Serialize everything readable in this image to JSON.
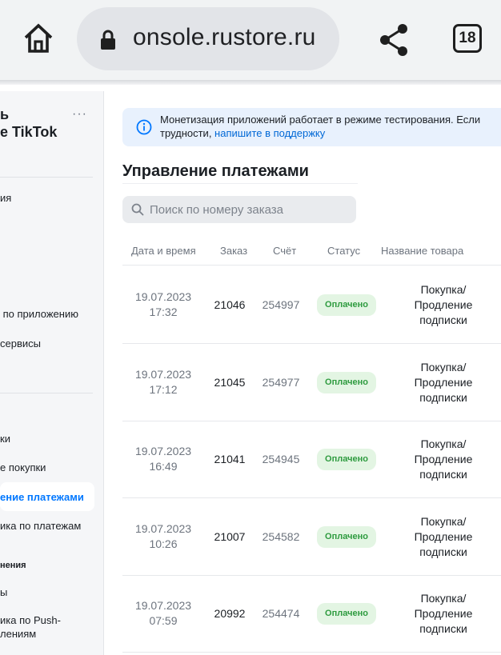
{
  "browser": {
    "url": "onsole.rustore.ru",
    "tab_count": "18",
    "icons": {
      "home": "home-icon",
      "lock": "lock-icon",
      "share": "share-icon"
    }
  },
  "sidebar": {
    "app_title": "ь\ne TikTok",
    "more": "···",
    "items": [
      {
        "label": "ия"
      },
      {
        "label": " по приложению"
      },
      {
        "label": "сервисы"
      },
      {
        "label": "ки"
      },
      {
        "label": "е покупки"
      },
      {
        "label": "ение платежами",
        "active": true
      },
      {
        "label": "ика по платежам"
      },
      {
        "label": "нения",
        "small": true
      },
      {
        "label": "ы"
      },
      {
        "label": "ика по Push-\nлениям"
      }
    ]
  },
  "banner": {
    "text_line1": "Монетизация приложений работает в режиме тестирования. Если",
    "text_line2_prefix": "трудности, ",
    "link": "напишите в поддержку"
  },
  "page_title": "Управление платежами",
  "search": {
    "placeholder": "Поиск по номеру заказа"
  },
  "table": {
    "columns": [
      "Дата и время",
      "Заказ",
      "Счёт",
      "Статус",
      "Название товара"
    ],
    "rows": [
      {
        "date": "19.07.2023",
        "time": "17:32",
        "order": "21046",
        "bill": "254997",
        "status": "Оплачено",
        "product": "Покупка/ Продление подписки"
      },
      {
        "date": "19.07.2023",
        "time": "17:12",
        "order": "21045",
        "bill": "254977",
        "status": "Оплачено",
        "product": "Покупка/ Продление подписки"
      },
      {
        "date": "19.07.2023",
        "time": "16:49",
        "order": "21041",
        "bill": "254945",
        "status": "Оплачено",
        "product": "Покупка/ Продление подписки"
      },
      {
        "date": "19.07.2023",
        "time": "10:26",
        "order": "21007",
        "bill": "254582",
        "status": "Оплачено",
        "product": "Покупка/ Продление подписки"
      },
      {
        "date": "19.07.2023",
        "time": "07:59",
        "order": "20992",
        "bill": "254474",
        "status": "Оплачено",
        "product": "Покупка/ Продление подписки"
      }
    ]
  },
  "colors": {
    "accent": "#0077ff",
    "link": "#0068d6",
    "paid_bg": "#e3f5e3",
    "paid_text": "#2e9b3f",
    "banner_bg": "#e8f1fd"
  }
}
